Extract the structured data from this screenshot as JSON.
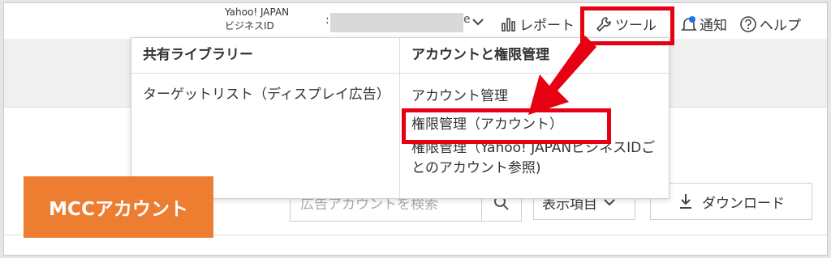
{
  "header": {
    "yid_label_line1": "Yahoo! JAPAN",
    "yid_label_line2": "ビジネスID",
    "yid_colon": ":",
    "yid_tail": "e",
    "report_label": "レポート",
    "tools_label": "ツール",
    "notify_label": "通知",
    "help_label": "ヘルプ"
  },
  "dropdown": {
    "left_heading": "共有ライブラリー",
    "left_items": [
      "ターゲットリスト（ディスプレイ広告）"
    ],
    "right_heading": "アカウントと権限管理",
    "right_items": [
      "アカウント管理",
      "権限管理（アカウント）",
      "権限管理（Yahoo! JAPANビジネスIDごとのアカウント参照)"
    ]
  },
  "toolbar": {
    "search_placeholder": "広告アカウントを検索",
    "display_items_label": "表示項目",
    "download_label": "ダウンロード"
  },
  "annotation": {
    "badge_label": "MCCアカウント",
    "highlight_color": "#e60012",
    "badge_color": "#ed7d31"
  }
}
